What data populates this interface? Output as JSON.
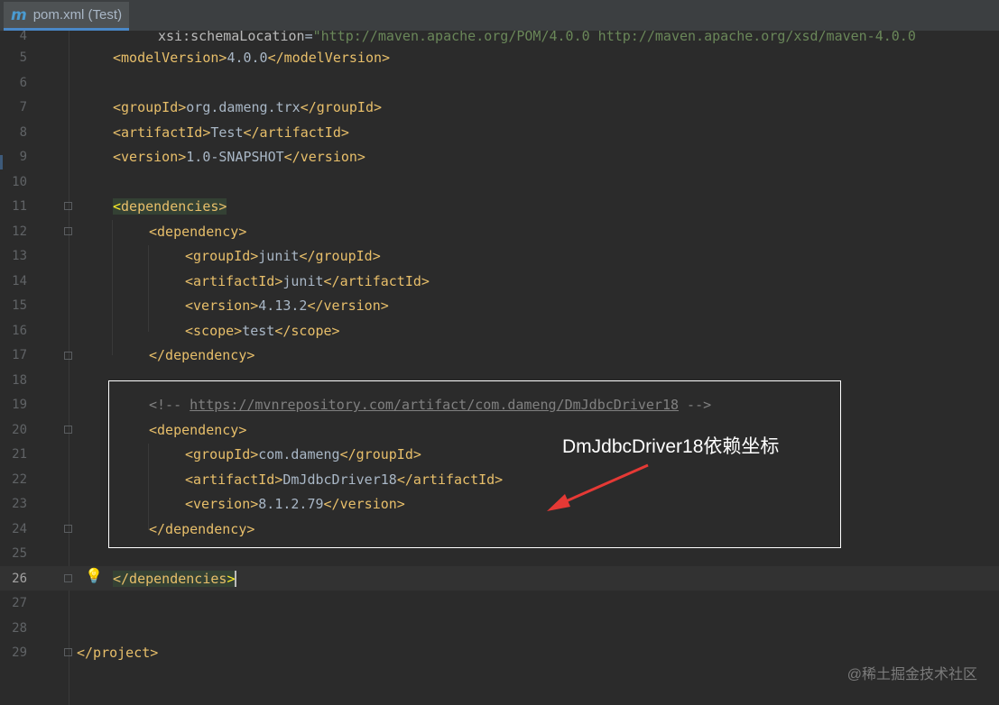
{
  "tab": {
    "icon": "maven-m-icon",
    "label": "pom.xml (Test)"
  },
  "lines": {
    "l4": {
      "num": "4",
      "attr": "xsi:schemaLocation",
      "eq": "=",
      "value": "\"http://maven.apache.org/POM/4.0.0 http://maven.apache.org/xsd/maven-4.0.0"
    },
    "l5": {
      "num": "5",
      "open": "<modelVersion>",
      "text": "4.0.0",
      "close": "</modelVersion>"
    },
    "l6": {
      "num": "6"
    },
    "l7": {
      "num": "7",
      "open": "<groupId>",
      "text": "org.dameng.trx",
      "close": "</groupId>"
    },
    "l8": {
      "num": "8",
      "open": "<artifactId>",
      "text": "Test",
      "close": "</artifactId>"
    },
    "l9": {
      "num": "9",
      "open": "<version>",
      "text": "1.0-SNAPSHOT",
      "close": "</version>"
    },
    "l10": {
      "num": "10"
    },
    "l11": {
      "num": "11",
      "bracket": "<",
      "rest": "dependencies>"
    },
    "l12": {
      "num": "12",
      "open": "<dependency>"
    },
    "l13": {
      "num": "13",
      "open": "<groupId>",
      "text": "junit",
      "close": "</groupId>"
    },
    "l14": {
      "num": "14",
      "open": "<artifactId>",
      "text": "junit",
      "close": "</artifactId>"
    },
    "l15": {
      "num": "15",
      "open": "<version>",
      "text": "4.13.2",
      "close": "</version>"
    },
    "l16": {
      "num": "16",
      "open": "<scope>",
      "text": "test",
      "close": "</scope>"
    },
    "l17": {
      "num": "17",
      "close": "</dependency>"
    },
    "l18": {
      "num": "18"
    },
    "l19": {
      "num": "19",
      "cmt_open": "<!-- ",
      "link": "https://mvnrepository.com/artifact/com.dameng/DmJdbcDriver18",
      "cmt_close": " -->"
    },
    "l20": {
      "num": "20",
      "open": "<dependency>"
    },
    "l21": {
      "num": "21",
      "open": "<groupId>",
      "text": "com.dameng",
      "close": "</groupId>"
    },
    "l22": {
      "num": "22",
      "open": "<artifactId>",
      "text": "DmJdbcDriver18",
      "close": "</artifactId>"
    },
    "l23": {
      "num": "23",
      "open": "<version>",
      "text": "8.1.2.79",
      "close": "</version>"
    },
    "l24": {
      "num": "24",
      "close": "</dependency>"
    },
    "l25": {
      "num": "25"
    },
    "l26": {
      "num": "26",
      "rest": "</dependencies",
      "bracket": ">"
    },
    "l27": {
      "num": "27"
    },
    "l28": {
      "num": "28"
    },
    "l29": {
      "num": "29",
      "close": "</project>"
    }
  },
  "annotation": {
    "text": "DmJdbcDriver18依赖坐标",
    "box_color": "#ffffff",
    "arrow_color": "#e53935"
  },
  "watermark": "@稀土掘金技术社区",
  "colors": {
    "background": "#2b2b2b",
    "tag": "#e8bf6a",
    "string": "#6a8759",
    "comment": "#808080",
    "text": "#a9b7c6"
  }
}
